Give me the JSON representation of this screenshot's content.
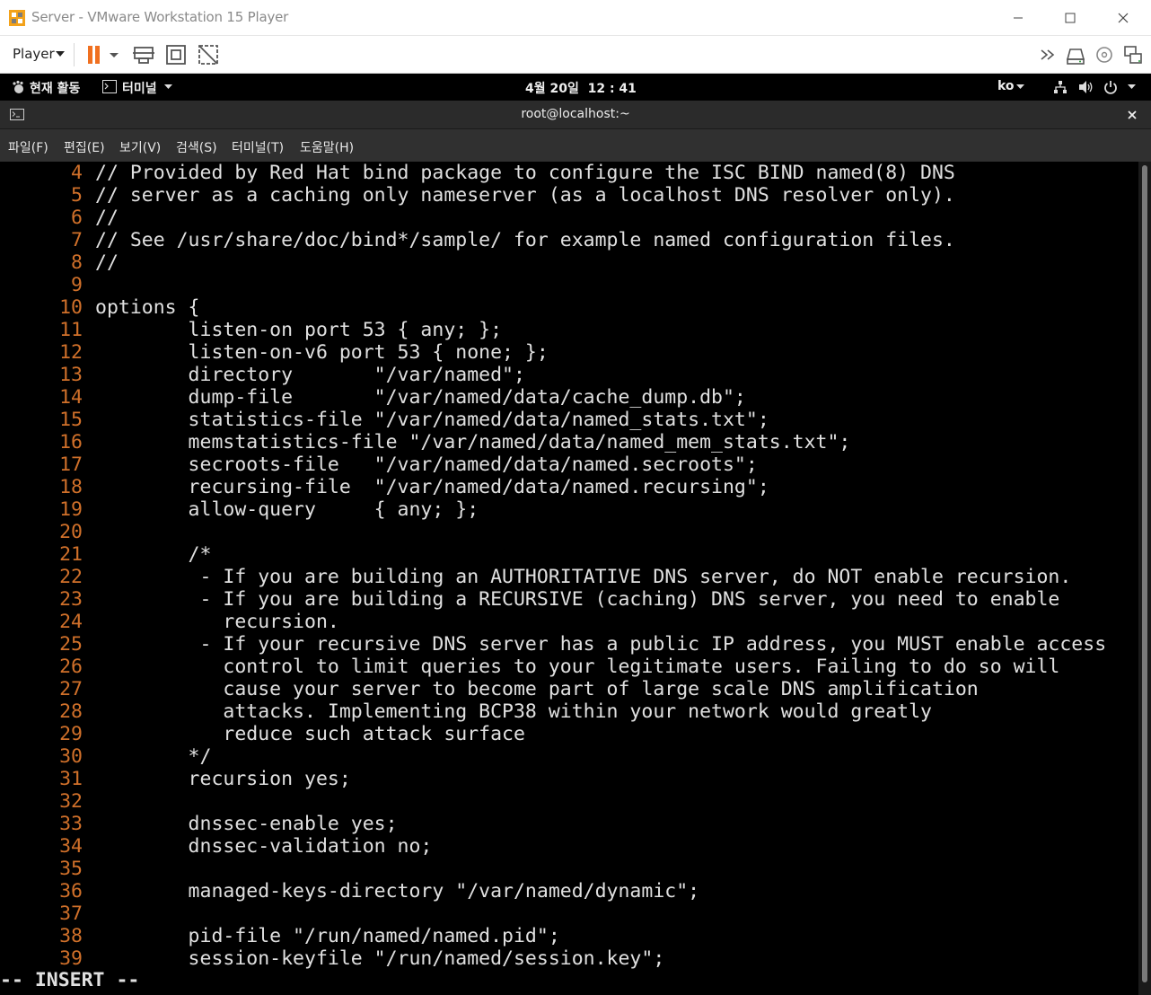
{
  "window": {
    "title": "Server - VMware Workstation 15 Player"
  },
  "toolbar": {
    "player_menu": "Player",
    "icons": [
      "pause-icon",
      "send-ctrl-alt-del-icon",
      "fullscreen-icon",
      "unity-icon",
      "forward-icon",
      "removable-device-icon",
      "cd-icon",
      "network-icon"
    ]
  },
  "gnome": {
    "activities": "현재 활동",
    "app_menu": "터미널",
    "clock": "4월 20일  12 : 41",
    "input_method": "ko"
  },
  "terminal": {
    "title": "root@localhost:~",
    "menu": [
      "파일(F)",
      "편집(E)",
      "보기(V)",
      "검색(S)",
      "터미널(T)",
      "도움말(H)"
    ],
    "lines": [
      {
        "n": "4",
        "text": "// Provided by Red Hat bind package to configure the ISC BIND named(8) DNS"
      },
      {
        "n": "5",
        "text": "// server as a caching only nameserver (as a localhost DNS resolver only)."
      },
      {
        "n": "6",
        "text": "//"
      },
      {
        "n": "7",
        "text": "// See /usr/share/doc/bind*/sample/ for example named configuration files."
      },
      {
        "n": "8",
        "text": "//"
      },
      {
        "n": "9",
        "text": ""
      },
      {
        "n": "10",
        "text": "options {"
      },
      {
        "n": "11",
        "text": "        listen-on port 53 { any; };"
      },
      {
        "n": "12",
        "text": "        listen-on-v6 port 53 { none; };"
      },
      {
        "n": "13",
        "text": "        directory       \"/var/named\";"
      },
      {
        "n": "14",
        "text": "        dump-file       \"/var/named/data/cache_dump.db\";"
      },
      {
        "n": "15",
        "text": "        statistics-file \"/var/named/data/named_stats.txt\";"
      },
      {
        "n": "16",
        "text": "        memstatistics-file \"/var/named/data/named_mem_stats.txt\";"
      },
      {
        "n": "17",
        "text": "        secroots-file   \"/var/named/data/named.secroots\";"
      },
      {
        "n": "18",
        "text": "        recursing-file  \"/var/named/data/named.recursing\";"
      },
      {
        "n": "19",
        "text": "        allow-query     { any; };"
      },
      {
        "n": "20",
        "text": ""
      },
      {
        "n": "21",
        "text": "        /*"
      },
      {
        "n": "22",
        "text": "         - If you are building an AUTHORITATIVE DNS server, do NOT enable recursion."
      },
      {
        "n": "23",
        "text": "         - If you are building a RECURSIVE (caching) DNS server, you need to enable"
      },
      {
        "n": "24",
        "text": "           recursion."
      },
      {
        "n": "25",
        "text": "         - If your recursive DNS server has a public IP address, you MUST enable access"
      },
      {
        "n": "26",
        "text": "           control to limit queries to your legitimate users. Failing to do so will"
      },
      {
        "n": "27",
        "text": "           cause your server to become part of large scale DNS amplification"
      },
      {
        "n": "28",
        "text": "           attacks. Implementing BCP38 within your network would greatly"
      },
      {
        "n": "29",
        "text": "           reduce such attack surface"
      },
      {
        "n": "30",
        "text": "        */"
      },
      {
        "n": "31",
        "text": "        recursion yes;"
      },
      {
        "n": "32",
        "text": ""
      },
      {
        "n": "33",
        "text": "        dnssec-enable yes;"
      },
      {
        "n": "34",
        "text": "        dnssec-validation no;"
      },
      {
        "n": "35",
        "text": ""
      },
      {
        "n": "36",
        "text": "        managed-keys-directory \"/var/named/dynamic\";"
      },
      {
        "n": "37",
        "text": ""
      },
      {
        "n": "38",
        "text": "        pid-file \"/run/named/named.pid\";"
      },
      {
        "n": "39",
        "text": "        session-keyfile \"/run/named/session.key\";"
      }
    ],
    "mode": "-- INSERT --"
  },
  "colors": {
    "line_number": "#d0702a",
    "code_text": "#e0e0e0",
    "pause_accent": "#f07020"
  }
}
